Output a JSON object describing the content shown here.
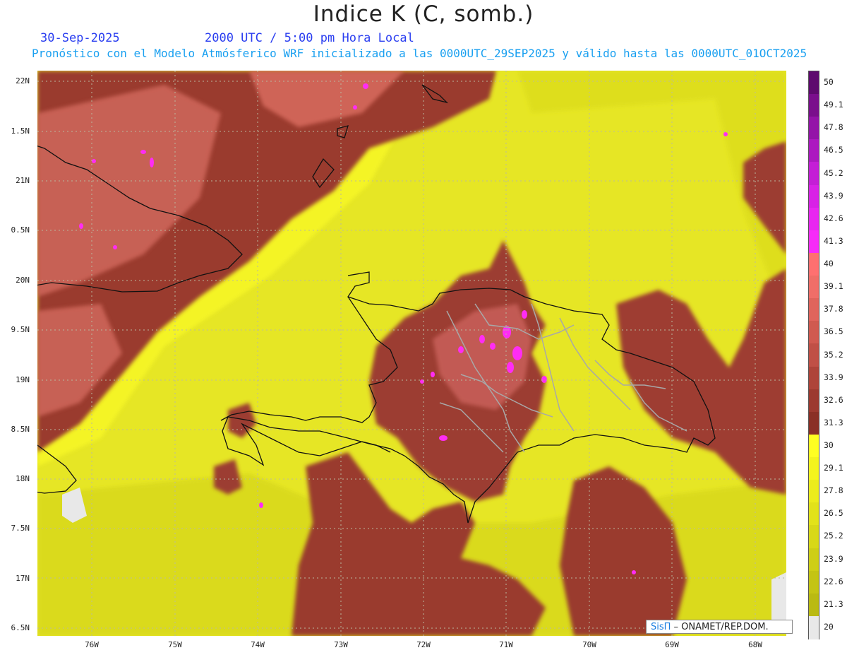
{
  "header": {
    "title": "Indice K (C, somb.)",
    "date": "30-Sep-2025",
    "time": "2000 UTC / 5:00 pm Hora Local",
    "forecast_line": "Pronóstico con el Modelo Atmósferico WRF inicializado a las 0000UTC_29SEP2025 y válido hasta las  0000UTC_01OCT2025"
  },
  "axes": {
    "lat_labels": [
      "22N",
      "1.5N",
      "21N",
      "0.5N",
      "20N",
      "9.5N",
      "19N",
      "8.5N",
      "18N",
      "7.5N",
      "17N",
      "6.5N"
    ],
    "lon_labels": [
      "76W",
      "75W",
      "74W",
      "73W",
      "72W",
      "71W",
      "70W",
      "69W",
      "68W"
    ]
  },
  "colorbar": {
    "labels": [
      "50",
      "49.1",
      "47.8",
      "46.5",
      "45.2",
      "43.9",
      "42.6",
      "41.3",
      "40",
      "39.1",
      "37.8",
      "36.5",
      "35.2",
      "33.9",
      "32.6",
      "31.3",
      "30",
      "29.1",
      "27.8",
      "26.5",
      "25.2",
      "23.9",
      "22.6",
      "21.3",
      "20"
    ],
    "colors": [
      "#5e0a6e",
      "#7a0f8c",
      "#9414a8",
      "#ac19c0",
      "#c41ed6",
      "#d822e6",
      "#e826f0",
      "#f62cf8",
      "#ff7070",
      "#f06e68",
      "#e0645c",
      "#d05a50",
      "#c05046",
      "#ae443a",
      "#9c3a30",
      "#8a3026",
      "#ffff22",
      "#f4f41e",
      "#ecec1c",
      "#e2e21a",
      "#d8d818",
      "#cece16",
      "#c4c414",
      "#baba12",
      "#e8e8e8"
    ]
  },
  "credit": {
    "brand": "SisΠ",
    "org": " – ONAMET/REP.DOM."
  }
}
